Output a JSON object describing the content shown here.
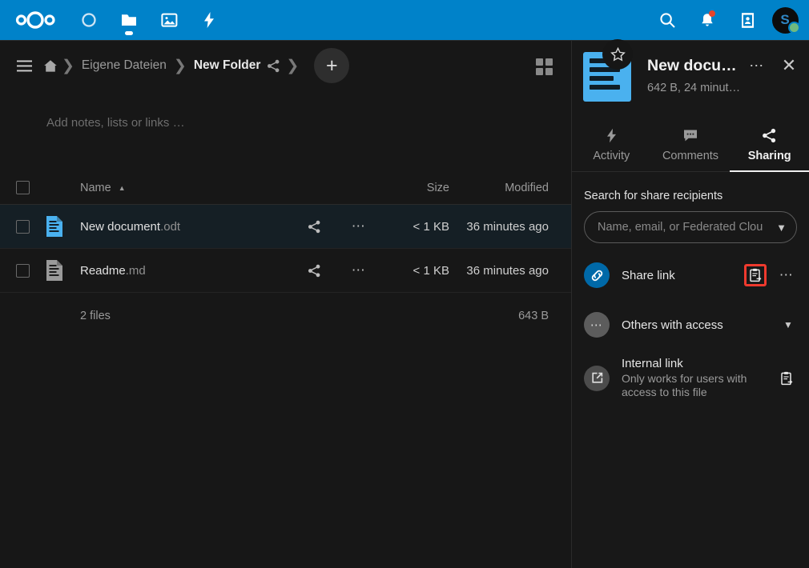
{
  "topbar": {
    "logo_name": "nextcloud-logo",
    "apps": [
      {
        "name": "dashboard",
        "icon": "circle-icon",
        "active": false
      },
      {
        "name": "files",
        "icon": "folder-icon",
        "active": true
      },
      {
        "name": "photos",
        "icon": "image-icon",
        "active": false
      },
      {
        "name": "activity",
        "icon": "lightning-icon",
        "active": false
      }
    ],
    "search_icon": "search-icon",
    "notifications_icon": "bell-icon",
    "notifications_badge": true,
    "contacts_icon": "contacts-icon",
    "avatar_letter": "S",
    "avatar_status": "online",
    "accent_color": "#0082c9"
  },
  "breadcrumb": {
    "menu_icon": "hamburger-icon",
    "home_icon": "home-icon",
    "items": [
      {
        "label": "Eigene Dateien",
        "current": false
      },
      {
        "label": "New Folder",
        "current": true
      }
    ],
    "share_icon": "share-icon",
    "new_label": "+",
    "grid_view_icon": "grid-view-icon"
  },
  "workspace": {
    "placeholder": "Add notes, lists or links …"
  },
  "filetable": {
    "columns": {
      "name": "Name",
      "size": "Size",
      "modified": "Modified",
      "sort_caret": "▲"
    },
    "rows": [
      {
        "name": "New document",
        "ext": ".odt",
        "size": "< 1 KB",
        "modified": "36 minutes ago",
        "icon_color": "#4ab1ef",
        "selected": true
      },
      {
        "name": "Readme",
        "ext": ".md",
        "size": "< 1 KB",
        "modified": "36 minutes ago",
        "icon_color": "#9a9a9a",
        "selected": false
      }
    ],
    "summary": {
      "files": "2 files",
      "size": "643 B"
    }
  },
  "sidebar": {
    "file_title": "New docu…",
    "file_meta": "642 B, 24 minut…",
    "star_icon": "star-icon",
    "menu_icon": "ellipsis-icon",
    "close_icon": "close-icon",
    "tabs": [
      {
        "label": "Activity",
        "icon": "lightning-icon",
        "active": false
      },
      {
        "label": "Comments",
        "icon": "comment-icon",
        "active": false
      },
      {
        "label": "Sharing",
        "icon": "share-icon",
        "active": true
      }
    ],
    "sharing": {
      "search_label": "Search for share recipients",
      "search_placeholder": "Name, email, or Federated Clou",
      "chevron_icon": "chevron-down-icon",
      "share_link": {
        "title": "Share link",
        "icon": "link-icon",
        "copy_icon": "copy-link-icon",
        "menu_icon": "ellipsis-icon",
        "highlight_color": "#ef3a2e"
      },
      "others_with_access": {
        "title": "Others with access",
        "icon": "ellipsis-avatar-icon",
        "chevron_icon": "chevron-down-icon"
      },
      "internal_link": {
        "title": "Internal link",
        "subtitle": "Only works for users with access to this file",
        "icon": "external-link-icon",
        "copy_icon": "copy-link-icon"
      }
    }
  }
}
